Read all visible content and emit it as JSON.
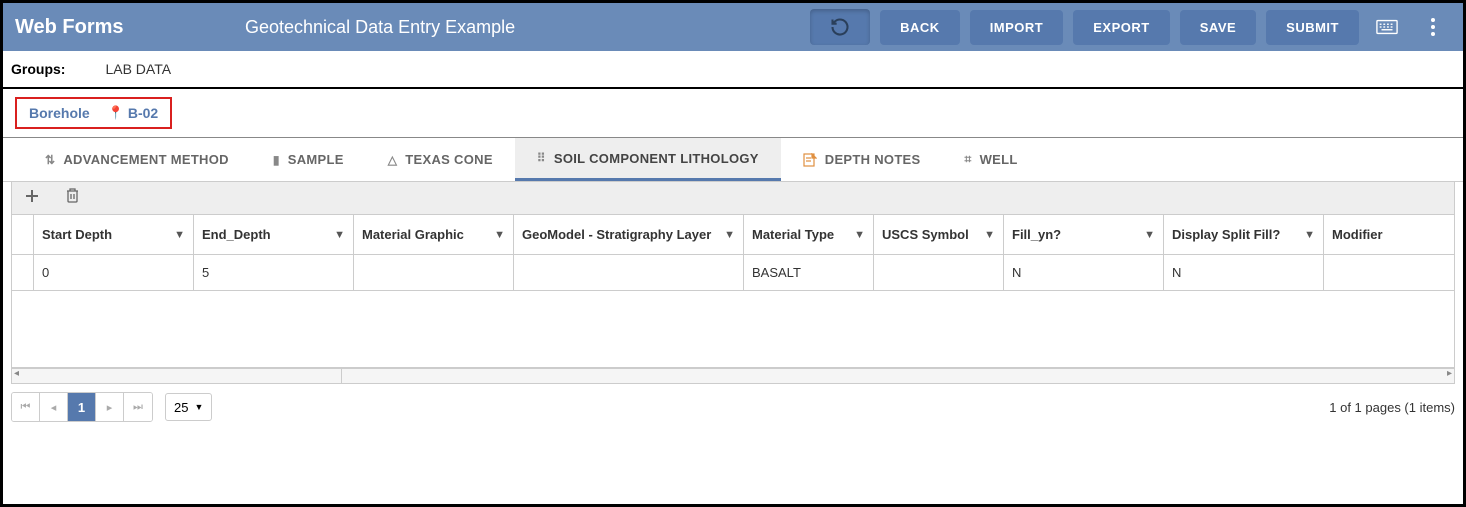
{
  "header": {
    "title": "Web Forms",
    "subtitle": "Geotechnical Data Entry Example",
    "buttons": {
      "back": "BACK",
      "import": "IMPORT",
      "export": "EXPORT",
      "save": "SAVE",
      "submit": "SUBMIT"
    }
  },
  "groups": {
    "label": "Groups:",
    "value": "LAB DATA"
  },
  "borehole": {
    "label": "Borehole",
    "value": "B-02"
  },
  "tabs": [
    {
      "label": "ADVANCEMENT METHOD"
    },
    {
      "label": "SAMPLE"
    },
    {
      "label": "TEXAS CONE"
    },
    {
      "label": "SOIL COMPONENT LITHOLOGY"
    },
    {
      "label": "DEPTH NOTES"
    },
    {
      "label": "WELL"
    }
  ],
  "columns": [
    "Start Depth",
    "End_Depth",
    "Material Graphic",
    "GeoModel - Stratigraphy Layer",
    "Material Type",
    "USCS Symbol",
    "Fill_yn?",
    "Display Split Fill?",
    "Modifier"
  ],
  "rows": [
    {
      "start_depth": "0",
      "end_depth": "5",
      "material_graphic": "",
      "geomodel": "",
      "material_type": "BASALT",
      "uscs": "",
      "fill_yn": "N",
      "display_split": "N",
      "modifier": ""
    }
  ],
  "footer": {
    "page": "1",
    "page_size": "25",
    "info": "1 of 1 pages (1 items)"
  }
}
